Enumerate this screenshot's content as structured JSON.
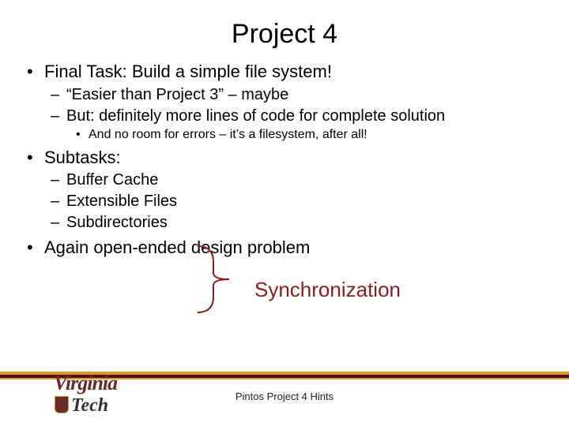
{
  "title": "Project 4",
  "bullets": {
    "b1": "Final Task: Build a simple file system!",
    "b1_1": "“Easier than Project 3” – maybe",
    "b1_2": "But: definitely more lines of code for complete solution",
    "b1_2_1": "And no room for errors – it’s a filesystem, after all!",
    "b2": "Subtasks:",
    "b2_1": "Buffer Cache",
    "b2_2": "Extensible Files",
    "b2_3": "Subdirectories",
    "b3": "Again open-ended design problem"
  },
  "annotation": "Synchronization",
  "footnote": "Pintos Project 4 Hints",
  "logo": {
    "part1": "Virginia",
    "part2": "Tech"
  },
  "colors": {
    "maroon": "#8b1d1d",
    "gold": "#d59a2f",
    "dark_maroon": "#5a0f0f"
  }
}
